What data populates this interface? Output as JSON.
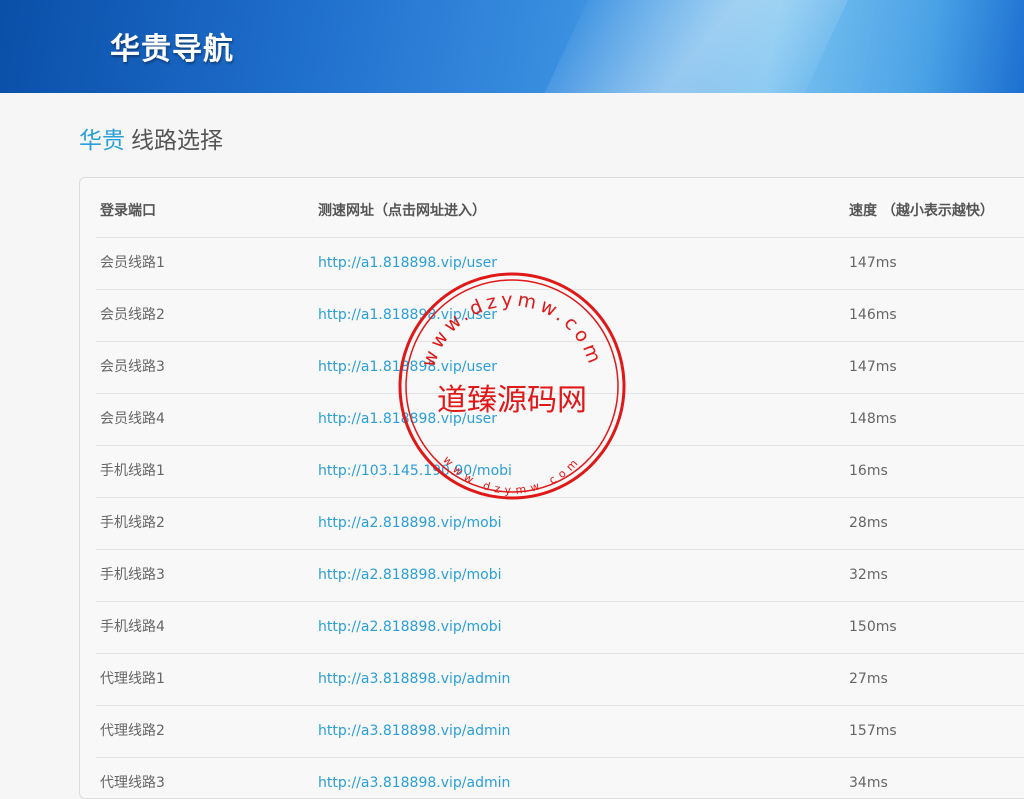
{
  "brand": "华贵导航",
  "heading": {
    "accent": "华贵",
    "rest": "线路选择"
  },
  "table": {
    "headers": [
      "登录端口",
      "测速网址（点击网址进入）",
      "速度 （越小表示越快）"
    ],
    "rows": [
      {
        "name": "会员线路1",
        "url": "http://a1.818898.vip/user",
        "speed": "147ms"
      },
      {
        "name": "会员线路2",
        "url": "http://a1.818898.vip/user",
        "speed": "146ms"
      },
      {
        "name": "会员线路3",
        "url": "http://a1.818898.vip/user",
        "speed": "147ms"
      },
      {
        "name": "会员线路4",
        "url": "http://a1.818898.vip/user",
        "speed": "148ms"
      },
      {
        "name": "手机线路1",
        "url": "http://103.145.190.90/mobi",
        "speed": "16ms"
      },
      {
        "name": "手机线路2",
        "url": "http://a2.818898.vip/mobi",
        "speed": "28ms"
      },
      {
        "name": "手机线路3",
        "url": "http://a2.818898.vip/mobi",
        "speed": "32ms"
      },
      {
        "name": "手机线路4",
        "url": "http://a2.818898.vip/mobi",
        "speed": "150ms"
      },
      {
        "name": "代理线路1",
        "url": "http://a3.818898.vip/admin",
        "speed": "27ms"
      },
      {
        "name": "代理线路2",
        "url": "http://a3.818898.vip/admin",
        "speed": "157ms"
      },
      {
        "name": "代理线路3",
        "url": "http://a3.818898.vip/admin",
        "speed": "34ms"
      }
    ]
  },
  "watermark": {
    "center": "道臻源码网",
    "top_ring": "www.dzymw.com",
    "bottom_ring": "www.dzymw.com",
    "color": "#e01818"
  }
}
